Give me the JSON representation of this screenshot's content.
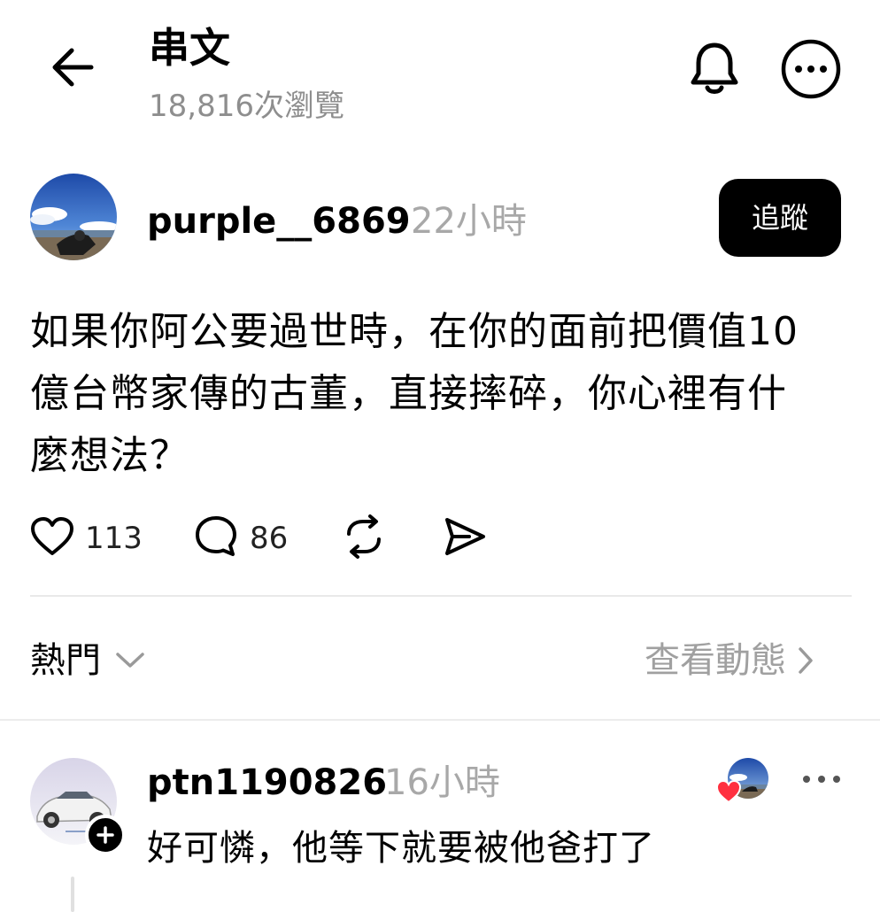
{
  "header": {
    "back_icon": "arrow-left-icon",
    "title": "串文",
    "views": "18,816次瀏覽",
    "bell_icon": "bell-icon",
    "more_icon": "more-circle-icon"
  },
  "post": {
    "author": "purple__6869",
    "time": "22小時",
    "follow_label": "追蹤",
    "text_lines": [
      "如果你阿公要過世時，在你的面前把價值10",
      "億台幣家傳的古董，直接摔碎，你心裡有什",
      "麼想法？"
    ],
    "likes": "113",
    "comments": "86",
    "icons": [
      "heart-icon",
      "comment-icon",
      "repost-icon",
      "share-icon"
    ]
  },
  "sort": {
    "label": "熱門",
    "activity": "查看動態"
  },
  "comment": {
    "author": "ptn1190826",
    "time": "16小時",
    "text": "好可憐，他等下就要被他爸打了"
  },
  "colors": {
    "text_primary": "#000000",
    "text_secondary": "#8e8e8e",
    "follow_bg": "#000000",
    "follow_text": "#ffffff",
    "divider": "#e9e9e9",
    "heart_badge": "#ff3040"
  }
}
